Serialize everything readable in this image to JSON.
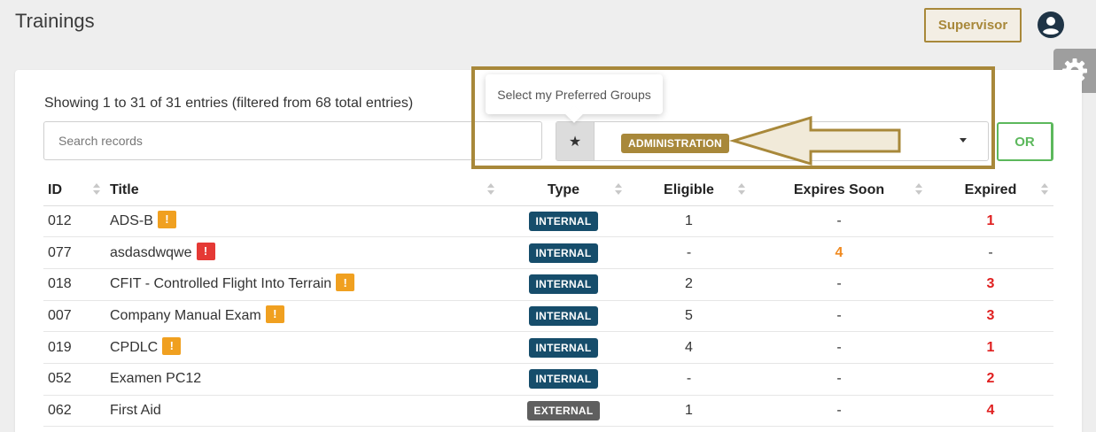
{
  "header": {
    "title": "Trainings",
    "supervisor_label": "Supervisor",
    "accent": "#a8883a"
  },
  "filters": {
    "entries_info": "Showing 1 to 31 of 31 entries (filtered from 68 total entries)",
    "search_placeholder": "Search records",
    "star_label": "★",
    "selected_group": "ADMINISTRATION",
    "tooltip": "Select my Preferred Groups",
    "or_label": "OR"
  },
  "table": {
    "columns": [
      "ID",
      "Title",
      "Type",
      "Eligible",
      "Expires Soon",
      "Expired"
    ],
    "rows": [
      {
        "id": "012",
        "title": "ADS-B",
        "warn": "orange",
        "type": "INTERNAL",
        "eligible": "1",
        "expires_soon": "-",
        "expired": "1"
      },
      {
        "id": "077",
        "title": "asdasdwqwe",
        "warn": "red",
        "type": "INTERNAL",
        "eligible": "-",
        "expires_soon": "4",
        "expired": "-"
      },
      {
        "id": "018",
        "title": "CFIT - Controlled Flight Into Terrain",
        "warn": "orange",
        "type": "INTERNAL",
        "eligible": "2",
        "expires_soon": "-",
        "expired": "3"
      },
      {
        "id": "007",
        "title": "Company Manual Exam",
        "warn": "orange",
        "type": "INTERNAL",
        "eligible": "5",
        "expires_soon": "-",
        "expired": "3"
      },
      {
        "id": "019",
        "title": "CPDLC",
        "warn": "orange",
        "type": "INTERNAL",
        "eligible": "4",
        "expires_soon": "-",
        "expired": "1"
      },
      {
        "id": "052",
        "title": "Examen PC12",
        "warn": "",
        "type": "INTERNAL",
        "eligible": "-",
        "expires_soon": "-",
        "expired": "2"
      },
      {
        "id": "062",
        "title": "First Aid",
        "warn": "",
        "type": "EXTERNAL",
        "eligible": "1",
        "expires_soon": "-",
        "expired": "4"
      }
    ]
  },
  "icons": {
    "account": "account-circle-icon",
    "settings": "gear-icon",
    "warning": "exclamation-icon",
    "sort": "sort-icon"
  }
}
